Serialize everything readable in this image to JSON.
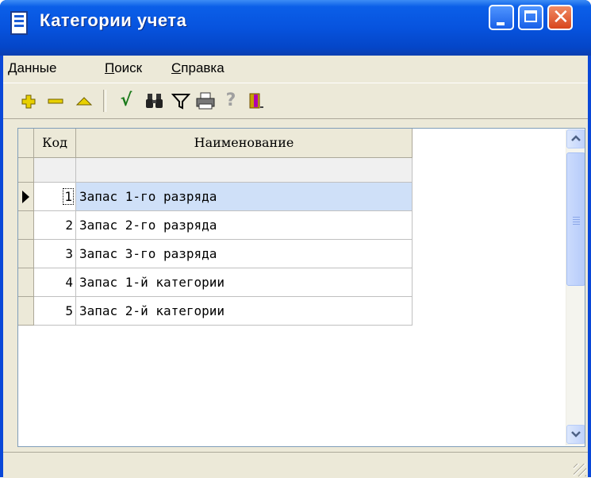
{
  "window": {
    "title": "Категории учета",
    "minimize": "minimize",
    "maximize": "maximize",
    "close": "✕"
  },
  "menu": [
    {
      "label": "Данные",
      "accel": "Д",
      "rest": "анные"
    },
    {
      "label": "Поиск",
      "accel": "П",
      "rest": "оиск"
    },
    {
      "label": "Справка",
      "accel": "С",
      "rest": "правка"
    }
  ],
  "toolbar": {
    "buttons": [
      {
        "name": "add-icon",
        "glyph": "✚",
        "color": "#d8c000"
      },
      {
        "name": "remove-icon",
        "glyph": "—",
        "color": "#d8c000"
      },
      {
        "name": "edit-up-icon",
        "glyph": "▲",
        "color": "#d8c000"
      },
      {
        "name": "check-icon",
        "glyph": "√",
        "color": "#1a7a1a"
      },
      {
        "name": "binoculars-icon",
        "glyph": "⚲",
        "color": "#202020"
      },
      {
        "name": "filter-icon",
        "glyph": "▽",
        "color": "#000080"
      },
      {
        "name": "printer-icon",
        "glyph": "⎙",
        "color": "#404040"
      },
      {
        "name": "help-icon",
        "glyph": "?",
        "color": "#a0a0a0"
      },
      {
        "name": "exit-door-icon",
        "glyph": "▮",
        "color": "#a000a0"
      }
    ]
  },
  "grid": {
    "columns": {
      "code": "Код",
      "name": "Наименование"
    },
    "rows": [
      {
        "code": "1",
        "name": "Запас 1-го разряда"
      },
      {
        "code": "2",
        "name": "Запас 2-го разряда"
      },
      {
        "code": "3",
        "name": "Запас 3-го разряда"
      },
      {
        "code": "4",
        "name": "Запас 1-й категории"
      },
      {
        "code": "5",
        "name": "Запас 2-й категории"
      }
    ],
    "selected_row": 0
  },
  "colors": {
    "title_bar": "#0753de",
    "selection": "#cfe0f8",
    "client_bg": "#ece9d8"
  }
}
